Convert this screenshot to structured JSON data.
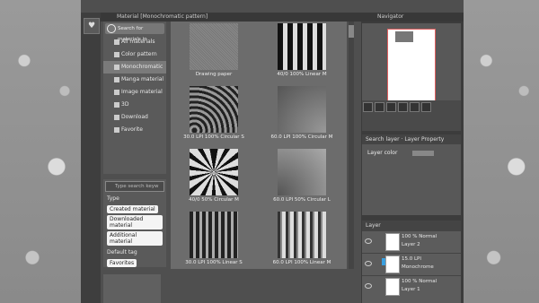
{
  "material_panel": {
    "title": "Material [Monochromatic pattern]",
    "search_placeholder": "Search for materials in",
    "tree": [
      {
        "label": "All materials",
        "selected": false
      },
      {
        "label": "Color pattern",
        "selected": false
      },
      {
        "label": "Monochromatic",
        "selected": true
      },
      {
        "label": "Manga material",
        "selected": false
      },
      {
        "label": "Image material",
        "selected": false
      },
      {
        "label": "3D",
        "selected": false
      },
      {
        "label": "Download",
        "selected": false
      },
      {
        "label": "Favorite",
        "selected": false
      }
    ],
    "tag_search_placeholder": "Type search keyw",
    "type_label": "Type",
    "type_tags": [
      "Created material",
      "Downloaded material",
      "Additional material"
    ],
    "default_tag_label": "Default tag",
    "default_tags": [
      "Favorites"
    ],
    "materials": [
      {
        "caption": "Drawing paper",
        "pattern": "t1"
      },
      {
        "caption": "40/0 100% Linear M",
        "pattern": "t2"
      },
      {
        "caption": "30.0 LPI 100% Circular S",
        "pattern": "t3"
      },
      {
        "caption": "60.0 LPI 100% Circular M",
        "pattern": "t4"
      },
      {
        "caption": "40/0 50% Circular M",
        "pattern": "t5"
      },
      {
        "caption": "60.0 LPI 50% Circular L",
        "pattern": "t6"
      },
      {
        "caption": "30.0 LPI 100% Linear S",
        "pattern": "t7"
      },
      {
        "caption": "60.0 LPI 100% Linear M",
        "pattern": "t8"
      }
    ]
  },
  "navigator": {
    "title": "Navigator"
  },
  "layer_property": {
    "tab_search": "Search layer",
    "tab_title": "Layer Property",
    "layer_color_label": "Layer color"
  },
  "layers": {
    "tab_title": "Layer",
    "rows": [
      {
        "line1": "100 % Normal",
        "line2": "Layer 2",
        "selected": false
      },
      {
        "line1": "15.0 LPI",
        "line2": "Monochrome",
        "selected": false
      },
      {
        "line1": "100 % Normal",
        "line2": "Layer 1",
        "selected": false
      }
    ]
  },
  "colors": {
    "selection_blue": "#3aa0e0",
    "doc_border": "#e06060"
  }
}
